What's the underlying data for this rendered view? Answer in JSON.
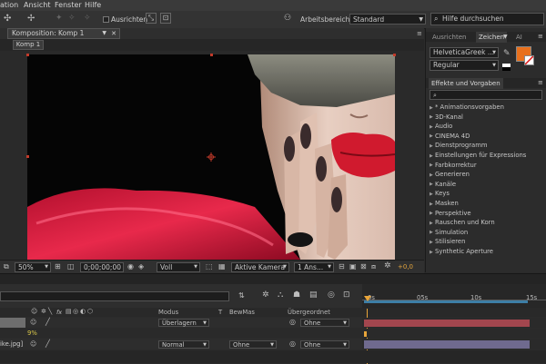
{
  "menu": [
    "ation",
    "Ansicht",
    "Fenster",
    "Hilfe"
  ],
  "toolbar": {
    "ausrichten_label": "Ausrichten",
    "arbeitsbereich_label": "Arbeitsbereich:",
    "arbeitsbereich_value": "Standard",
    "search_placeholder": "Hilfe durchsuchen"
  },
  "composition": {
    "panel_tab": "Komposition: Komp 1",
    "sub_tab": "Komp 1"
  },
  "viewer_bar": {
    "zoom": "50%",
    "timecode": "0;00;00;00",
    "resolution": "Voll",
    "camera": "Aktive Kamera",
    "views": "1 Ans...",
    "exposure": "+0,0"
  },
  "right_panel": {
    "tabs": [
      "Ausrichten",
      "Zeichen",
      "AI"
    ],
    "font_name": "HelveticaGreek ...",
    "font_style": "Regular",
    "effects_tab": "Effekte und Vorgaben",
    "effects_categories": [
      "* Animationsvorgaben",
      "3D-Kanal",
      "Audio",
      "CINEMA 4D",
      "Dienstprogramm",
      "Einstellungen für Expressions",
      "Farbkorrektur",
      "Generieren",
      "Kanäle",
      "Keys",
      "Masken",
      "Perspektive",
      "Rauschen und Korn",
      "Simulation",
      "Stilisieren",
      "Synthetic Aperture"
    ],
    "accent_color": "#e8701c"
  },
  "timeline": {
    "columns": {
      "modus": "Modus",
      "t": "T",
      "bewmas": "BewMas",
      "uebergeordnet": "Übergeordnet"
    },
    "ruler": [
      "0s",
      "05s",
      "10s",
      "15s"
    ],
    "rows": [
      {
        "name": "",
        "mode": "Überlagern",
        "bewmas": "",
        "parent": "Ohne",
        "bar_color": "#a2464e"
      },
      {
        "name": "9%",
        "mode": "",
        "bewmas": "",
        "parent": "",
        "bar_color": ""
      },
      {
        "name": "ike.jpg]",
        "mode": "Normal",
        "bewmas": "Ohne",
        "parent": "Ohne",
        "bar_color": "#6f6a8e"
      }
    ]
  }
}
